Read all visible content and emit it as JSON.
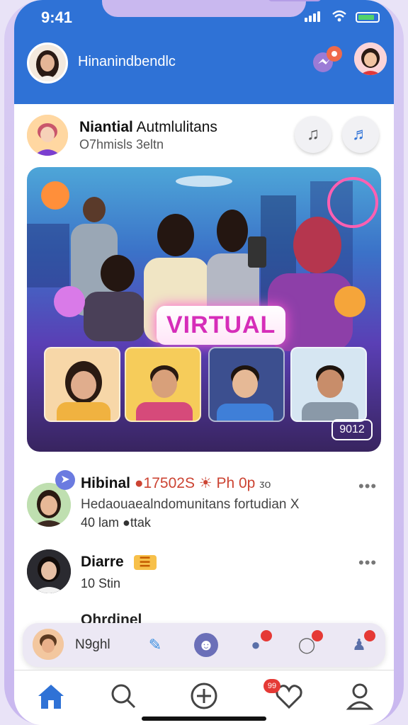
{
  "status": {
    "time": "9:41"
  },
  "header": {
    "title": "Hinanindbendlc",
    "icons": [
      "profile-avatar",
      "messenger-icon",
      "profile-avatar-2"
    ]
  },
  "post": {
    "name_bold": "Niantial",
    "name_rest": "Autmlulitans",
    "subtitle": "O7hmisls 3eltn",
    "buttons": [
      "music-note-icon",
      "music-note-icon"
    ],
    "hero_badge": "VIRTUAL",
    "hero_counter": "9012"
  },
  "feed": [
    {
      "name": "Hibinal",
      "name_extra": "●17502S ☀ Ph 0p",
      "name_tail": "ᴣo",
      "line": "Hedaouaealndomunitans fortudian X",
      "meta": "40  lam ●ttak"
    },
    {
      "name": "Diarre",
      "tag": "☰",
      "meta": "10  Stin"
    }
  ],
  "partial_item": {
    "name": "Ohrdinel"
  },
  "quick_bar": {
    "name": "N9ghl"
  },
  "nav": {
    "items": [
      "home-icon",
      "search-icon",
      "add-icon",
      "heart-icon",
      "profile-icon"
    ],
    "badge": "99"
  },
  "colors": {
    "primary": "#2f72d6",
    "frame": "#c9b8ef",
    "accent_pink": "#d62db9"
  }
}
